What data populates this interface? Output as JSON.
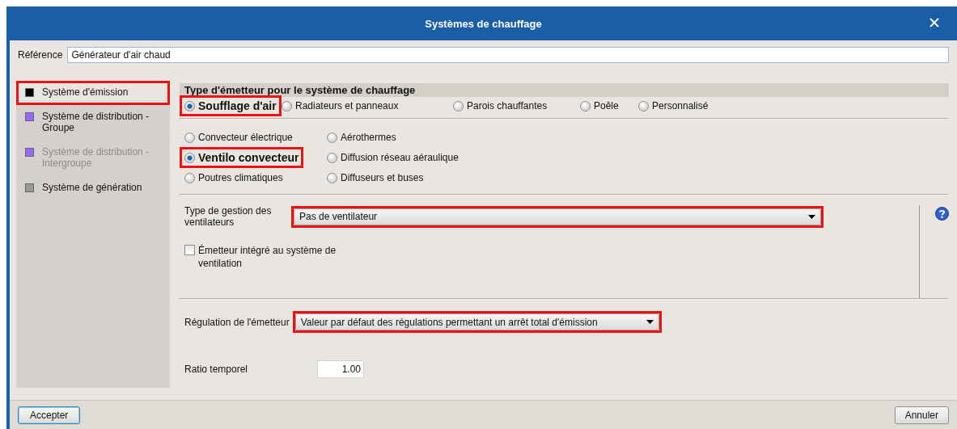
{
  "window": {
    "title": "Systèmes de chauffage"
  },
  "reference": {
    "label": "Référence",
    "value": "Générateur d'air chaud"
  },
  "sidebar": {
    "items": [
      {
        "label": "Système d'émission",
        "color": "#000000",
        "selected": true,
        "disabled": false,
        "highlighted": true
      },
      {
        "label": "Système de distribution - Groupe",
        "color": "#9966ff",
        "selected": false,
        "disabled": false,
        "highlighted": false
      },
      {
        "label": "Système de distribution - Intergroupe",
        "color": "#9966ff",
        "selected": false,
        "disabled": true,
        "highlighted": false
      },
      {
        "label": "Système de génération",
        "color": "#999999",
        "selected": false,
        "disabled": false,
        "highlighted": false
      }
    ]
  },
  "emitter_type": {
    "heading": "Type d'émetteur pour le système de chauffage",
    "options": [
      {
        "label": "Soufflage d'air",
        "selected": true,
        "highlighted": true
      },
      {
        "label": "Radiateurs et panneaux",
        "selected": false,
        "highlighted": false
      },
      {
        "label": "Parois chauffantes",
        "selected": false,
        "highlighted": false
      },
      {
        "label": "Poêle",
        "selected": false,
        "highlighted": false
      },
      {
        "label": "Personnalisé",
        "selected": false,
        "highlighted": false
      }
    ]
  },
  "emitter_subtype": {
    "options": [
      {
        "label": "Convecteur électrique",
        "selected": false,
        "highlighted": false
      },
      {
        "label": "Aérothermes",
        "selected": false,
        "highlighted": false
      },
      {
        "label": "Ventilo convecteur",
        "selected": true,
        "highlighted": true
      },
      {
        "label": "Diffusion réseau aéraulique",
        "selected": false,
        "highlighted": false
      },
      {
        "label": "Poutres climatiques",
        "selected": false,
        "highlighted": false
      },
      {
        "label": "Diffuseurs et buses",
        "selected": false,
        "highlighted": false
      }
    ]
  },
  "fan_management": {
    "label": "Type de gestion des ventilateurs",
    "value": "Pas de ventilateur",
    "highlighted": true
  },
  "integrated": {
    "label": "Émetteur intégré au système de ventilation",
    "checked": false
  },
  "regulation": {
    "label": "Régulation de l'émetteur",
    "value": "Valeur par défaut des régulations permettant un arrêt total d'émission",
    "highlighted": true
  },
  "ratio": {
    "label": "Ratio temporel",
    "value": "1.00"
  },
  "buttons": [
    {
      "label": "Accepter",
      "kind": "default"
    },
    {
      "label": "Annuler",
      "kind": "normal"
    }
  ]
}
